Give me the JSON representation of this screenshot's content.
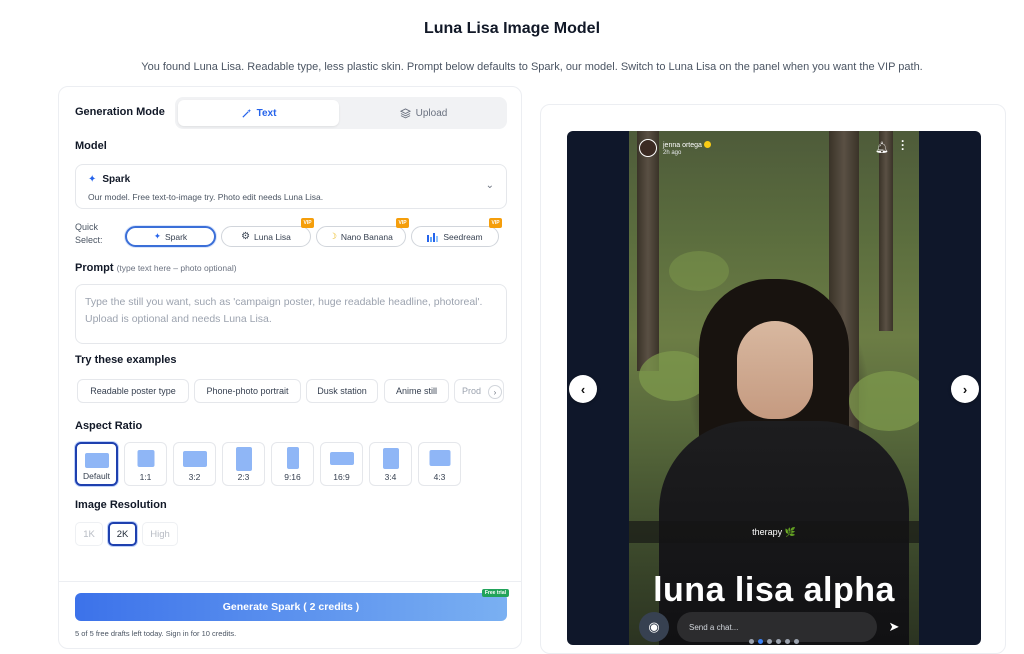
{
  "header": {
    "title": "Luna Lisa Image Model",
    "subtitle": "You found Luna Lisa. Readable type, less plastic skin. Prompt below defaults to Spark, our model. Switch to Luna Lisa on the panel when you want the VIP path."
  },
  "generation_mode": {
    "label": "Generation Mode",
    "tabs": [
      {
        "label": "Text",
        "active": true,
        "icon": "magic-wand-icon"
      },
      {
        "label": "Upload",
        "active": false,
        "icon": "layers-icon"
      }
    ]
  },
  "model": {
    "label": "Model",
    "selected_name": "Spark",
    "selected_desc": "Our model. Free text-to-image try. Photo edit needs Luna Lisa."
  },
  "quick_select": {
    "label": "Quick Select:",
    "items": [
      {
        "label": "Spark",
        "active": true,
        "vip": false,
        "icon": "sparkle-icon"
      },
      {
        "label": "Luna Lisa",
        "active": false,
        "vip": true,
        "icon": "openai-icon"
      },
      {
        "label": "Nano Banana",
        "active": false,
        "vip": true,
        "icon": "banana-icon"
      },
      {
        "label": "Seedream",
        "active": false,
        "vip": true,
        "icon": "bar-chart-icon"
      }
    ],
    "vip_badge": "VIP"
  },
  "prompt": {
    "label": "Prompt",
    "hint": "(type text here – photo optional)",
    "placeholder": "Type the still you want, such as 'campaign poster, huge readable headline, photoreal'. Upload is optional and needs Luna Lisa."
  },
  "examples": {
    "label": "Try these examples",
    "items": [
      "Readable poster type",
      "Phone-photo portrait",
      "Dusk station",
      "Anime still",
      "Prod"
    ]
  },
  "aspect_ratio": {
    "label": "Aspect Ratio",
    "options": [
      {
        "label": "Default",
        "active": true
      },
      {
        "label": "1:1",
        "active": false
      },
      {
        "label": "3:2",
        "active": false
      },
      {
        "label": "2:3",
        "active": false
      },
      {
        "label": "9:16",
        "active": false
      },
      {
        "label": "16:9",
        "active": false
      },
      {
        "label": "3:4",
        "active": false
      },
      {
        "label": "4:3",
        "active": false
      }
    ]
  },
  "resolution": {
    "label": "Image Resolution",
    "options": [
      {
        "label": "1K",
        "state": "disabled"
      },
      {
        "label": "2K",
        "state": "active"
      },
      {
        "label": "High",
        "state": "disabled"
      }
    ]
  },
  "generate": {
    "label": "Generate Spark ( 2 credits )",
    "tag": "Free trial",
    "drafts_text": "5 of 5 free drafts left today. Sign in for 10 credits."
  },
  "preview": {
    "username": "jenna ortega",
    "time": "2h ago",
    "caption": "therapy 🌿",
    "overlay_text": "luna lisa alpha",
    "chat_placeholder": "Send a chat...",
    "pager": {
      "count": 6,
      "current": 2
    }
  },
  "colors": {
    "accent": "#2563eb",
    "active_border": "#1e40af",
    "vip": "#f59e0b",
    "generate_start": "#3c72ea",
    "generate_end": "#7ab0f2"
  }
}
